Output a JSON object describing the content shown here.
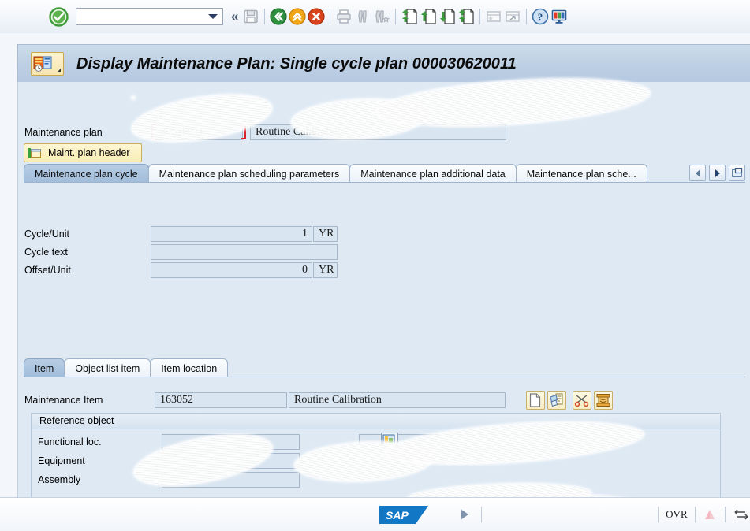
{
  "toolbar": {
    "ok_button": "enter-ok",
    "command_field_value": "",
    "command_field_placeholder": "",
    "back_chevron": "«",
    "icons": [
      {
        "name": "save-icon",
        "title": "Save"
      },
      {
        "name": "back-icon",
        "title": "Back"
      },
      {
        "name": "exit-icon",
        "title": "Exit"
      },
      {
        "name": "cancel-icon",
        "title": "Cancel"
      },
      {
        "name": "print-icon",
        "title": "Print"
      },
      {
        "name": "find-icon",
        "title": "Find"
      },
      {
        "name": "find-next-icon",
        "title": "Find Next"
      },
      {
        "name": "first-page-icon",
        "title": "First Page"
      },
      {
        "name": "previous-page-icon",
        "title": "Previous Page"
      },
      {
        "name": "next-page-icon",
        "title": "Next Page"
      },
      {
        "name": "last-page-icon",
        "title": "Last Page"
      },
      {
        "name": "create-session-icon",
        "title": "Create Session"
      },
      {
        "name": "create-shortcut-icon",
        "title": "Create Shortcut"
      },
      {
        "name": "help-icon",
        "title": "Help"
      },
      {
        "name": "customize-layout-icon",
        "title": "Customize Local Layout"
      }
    ]
  },
  "title": {
    "text": "Display Maintenance Plan: Single cycle plan 000030620011",
    "icon": "maintenance-plan-icon"
  },
  "header": {
    "plan_label": "Maintenance plan",
    "plan_number": "30620011",
    "plan_description": "Routine Calibration",
    "header_button": "Maint. plan header",
    "header_button_icon": "folder-arrow-icon"
  },
  "plan_tabs": {
    "items": [
      {
        "label": "Maintenance plan cycle",
        "selected": true
      },
      {
        "label": "Maintenance plan scheduling parameters",
        "selected": false
      },
      {
        "label": "Maintenance plan additional data",
        "selected": false
      },
      {
        "label": "Maintenance plan sche...",
        "selected": false
      }
    ],
    "nav_prev": "tab-scroll-left",
    "nav_next": "tab-scroll-right",
    "nav_list": "tab-list"
  },
  "cycle": {
    "fields": [
      {
        "label": "Cycle/Unit",
        "value": "1",
        "unit": "YR",
        "has_unit": true
      },
      {
        "label": "Cycle text",
        "value": "",
        "unit": "",
        "has_unit": false
      },
      {
        "label": "Offset/Unit",
        "value": "0",
        "unit": "YR",
        "has_unit": true
      }
    ]
  },
  "item_tabs": {
    "items": [
      {
        "label": "Item",
        "selected": true
      },
      {
        "label": "Object list item",
        "selected": false
      },
      {
        "label": "Item location",
        "selected": false
      }
    ]
  },
  "item": {
    "label": "Maintenance Item",
    "number": "163052",
    "description": "Routine Calibration",
    "buttons": [
      {
        "name": "new-document-icon"
      },
      {
        "name": "document-details-icon"
      },
      {
        "name": "scissors-cut-icon"
      },
      {
        "name": "paste-clipboard-icon"
      }
    ]
  },
  "reference_object": {
    "group_title": "Reference object",
    "rows": [
      {
        "label": "Functional loc.",
        "value": "",
        "redacted": true
      },
      {
        "label": "Equipment",
        "value": "",
        "redacted": true
      },
      {
        "label": "Assembly",
        "value": "",
        "redacted": false
      }
    ],
    "location_icon": "location-picker-icon"
  },
  "status_bar": {
    "logo": "SAP",
    "message": "",
    "insert_mode": "OVR",
    "servo_icon": "system-status-icon",
    "resize_icon": "resize-grip-icon",
    "expand_icon": "status-expand-icon"
  },
  "colors": {
    "background": "#dee9f3",
    "title_bar": "#bed0e4",
    "field_bg": "#d9e5f0",
    "accent_required": "#d8242a",
    "sap_blue": "#1277c4",
    "tab_selected": "#a8c3de"
  }
}
